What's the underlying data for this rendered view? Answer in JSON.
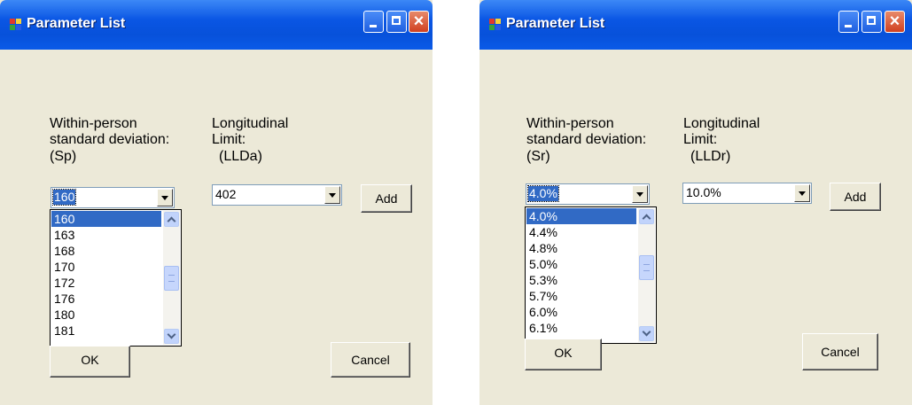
{
  "windows": [
    {
      "title": "Parameter List",
      "sd_label": [
        "Within-person",
        "standard deviation:",
        "(Sp)"
      ],
      "limit_label": [
        "Longitudinal",
        "Limit:",
        "(LLDa)"
      ],
      "sd_combo_value": "160",
      "limit_combo_value": "402",
      "add_label": "Add",
      "ok_label": "OK",
      "cancel_label": "Cancel",
      "dropdown_items": [
        "160",
        "163",
        "168",
        "170",
        "172",
        "176",
        "180",
        "181"
      ],
      "dropdown_selected": "160",
      "scroll_position": 0.5
    },
    {
      "title": "Parameter List",
      "sd_label": [
        "Within-person",
        "standard deviation:",
        "(Sr)"
      ],
      "limit_label": [
        "Longitudinal",
        "Limit:",
        "(LLDr)"
      ],
      "sd_combo_value": "4.0%",
      "limit_combo_value": "10.0%",
      "add_label": "Add",
      "ok_label": "OK",
      "cancel_label": "Cancel",
      "dropdown_items": [
        "4.0%",
        "4.4%",
        "4.8%",
        "5.0%",
        "5.3%",
        "5.7%",
        "6.0%",
        "6.1%"
      ],
      "dropdown_selected": "4.0%",
      "scroll_position": 0.4
    }
  ],
  "icons": {
    "app_icon": "app-window-icon",
    "minimize": "minimize-icon",
    "maximize": "maximize-icon",
    "close": "close-icon"
  }
}
